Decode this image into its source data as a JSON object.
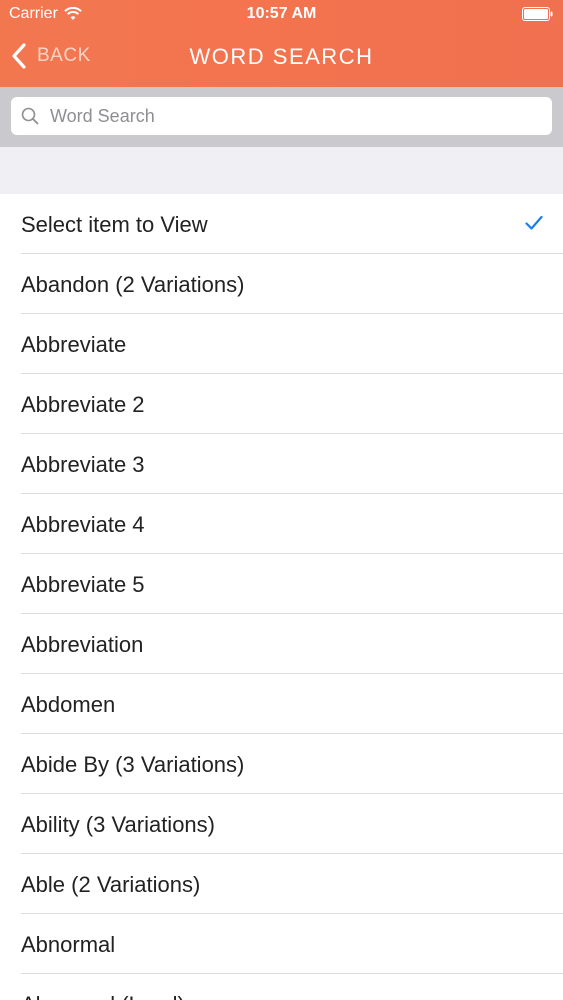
{
  "status_bar": {
    "carrier": "Carrier",
    "time": "10:57 AM"
  },
  "nav": {
    "back_label": "BACK",
    "title": "WORD SEARCH"
  },
  "search": {
    "placeholder": "Word Search",
    "value": ""
  },
  "colors": {
    "accent": "#f2734f",
    "check": "#1a7ef0"
  },
  "list": {
    "items": [
      {
        "label": "Select item to View",
        "selected": true
      },
      {
        "label": "Abandon (2 Variations)"
      },
      {
        "label": "Abbreviate"
      },
      {
        "label": "Abbreviate 2"
      },
      {
        "label": "Abbreviate 3"
      },
      {
        "label": "Abbreviate 4"
      },
      {
        "label": "Abbreviate 5"
      },
      {
        "label": "Abbreviation"
      },
      {
        "label": "Abdomen"
      },
      {
        "label": "Abide By (3 Variations)"
      },
      {
        "label": "Ability (3 Variations)"
      },
      {
        "label": "Able (2 Variations)"
      },
      {
        "label": "Abnormal"
      },
      {
        "label": "Abnormal (Lead)"
      }
    ]
  }
}
